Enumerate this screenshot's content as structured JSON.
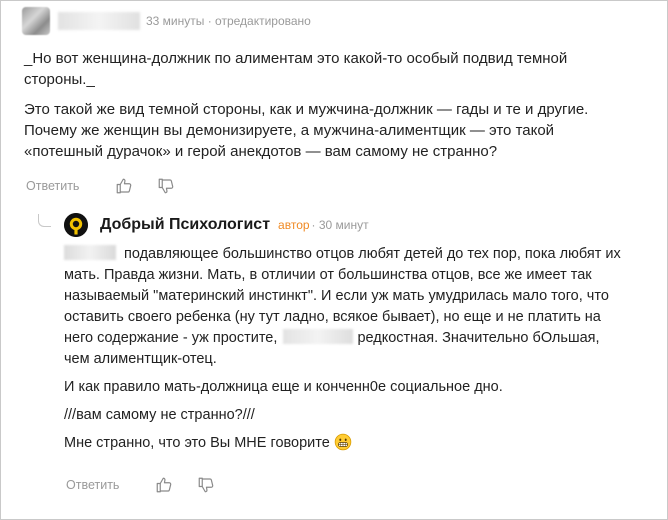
{
  "comment": {
    "meta": "33 минуты · отредактировано",
    "quote": "_Но вот женщина-должник по алиментам это какой-то особый подвид темной стороны._",
    "text": "Это такой же вид темной стороны, как и мужчина-должник — гады и те и другие. Почему же женщин вы демонизируете, а мужчина-алиментщик — это такой «потешный дурачок» и герой анекдотов — вам самому не странно?",
    "reply_label": "Ответить",
    "like_icon": "thumbs-up-icon",
    "dislike_icon": "thumbs-down-icon"
  },
  "reply": {
    "author": "Добрый Психологист",
    "badge": "автор",
    "meta": "· 30 минут",
    "p1_main": "подавляющее большинство отцов любят детей до тех пор, пока любят их мать. Правда жизни. Мать, в отличии от большинства отцов, все же имеет так называемый \"материнский инстинкт\". И если уж мать умудрилась мало того, что оставить своего ребенка (ну тут ладно, всякое бывает), но еще и не платить на него содержание - уж простите,",
    "p1_tail": "редкостная. Значительно бОльшая, чем алиментщик-отец.",
    "p2": "И как правило мать-должница еще и конченн0е социальное дно.",
    "p3": "///вам самому не странно?///",
    "p4": "Мне странно, что это Вы МНЕ говорите",
    "emoji": "grinning-face-icon",
    "reply_label": "Ответить"
  },
  "colors": {
    "author_badge": "#f08a24",
    "meta_text": "#9a9a9a",
    "body_text": "#222222"
  }
}
